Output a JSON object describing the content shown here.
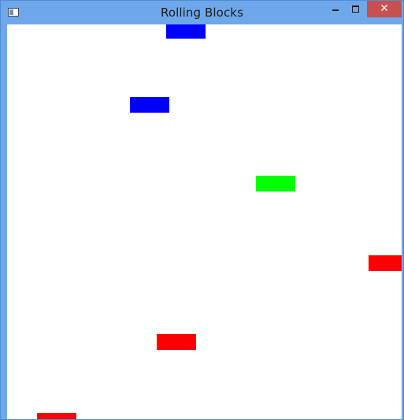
{
  "window": {
    "title": "Rolling Blocks",
    "close_glyph": "✕"
  },
  "blocks": [
    {
      "color": "#0000ff"
    },
    {
      "color": "#0000ff"
    },
    {
      "color": "#00ff00"
    },
    {
      "color": "#ff0000"
    },
    {
      "color": "#ff0000"
    },
    {
      "color": "#ff0000"
    }
  ]
}
